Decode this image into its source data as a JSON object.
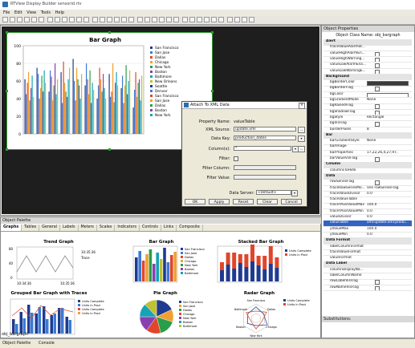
{
  "window": {
    "title": "RTView Display Builder   sensorid.rtv"
  },
  "menu": [
    "File",
    "Edit",
    "View",
    "Tools",
    "Help"
  ],
  "canvas_chart": {
    "title": "Bar Graph",
    "yticks": [
      "100",
      "80",
      "60",
      "40",
      "20",
      "0"
    ],
    "legend": [
      "San Francisco",
      "San Jose",
      "Dallas",
      "Chicago",
      "New York",
      "Boston",
      "Baltimore",
      "New Orleans",
      "Seattle",
      "Denver",
      "San Francisco",
      "San Jose",
      "Dallas",
      "Boston",
      "New York"
    ],
    "bars": [
      [
        62,
        75,
        48,
        70,
        85,
        55,
        40,
        68,
        52,
        30
      ],
      [
        45,
        68,
        72,
        35,
        60,
        80,
        55,
        42,
        66,
        50
      ],
      [
        58,
        40,
        65,
        82,
        38,
        62,
        75,
        48,
        35,
        70
      ],
      [
        70,
        52,
        38,
        58,
        75,
        45,
        62,
        80,
        55,
        42
      ],
      [
        38,
        66,
        55,
        48,
        62,
        72,
        48,
        36,
        78,
        58
      ],
      [
        52,
        48,
        80,
        42,
        55,
        35,
        68,
        58,
        45,
        62
      ],
      [
        66,
        72,
        45,
        62,
        40,
        58,
        52,
        70,
        60,
        38
      ],
      [
        42,
        58,
        62,
        75,
        68,
        50,
        40,
        55,
        72,
        66
      ]
    ],
    "colors": [
      "#1f3b8f",
      "#3a7bd5",
      "#e0462b",
      "#f0a030",
      "#2a9d4a",
      "#8a3fb0",
      "#16a2b8",
      "#c0c030"
    ]
  },
  "dialog": {
    "title": "Attach To XML Data",
    "property_name_label": "Property Name:",
    "property_name_value": "valueTable",
    "xml_source_label": "XML Source:",
    "xml_source_value": "update.xml",
    "data_key_label": "Data Key:",
    "data_key_value": "production_dates",
    "columns_label": "Column(s):",
    "columns_value": "*",
    "filter_label": "Filter:",
    "filter_column_label": "Filter Column:",
    "filter_value_label": "Filter Value:",
    "data_server_label": "Data Server:",
    "data_server_value": "<default>",
    "buttons": [
      "OK",
      "Apply",
      "Reset",
      "Clear",
      "Cancel"
    ]
  },
  "palette": {
    "header": "Object Palette",
    "tabs": [
      "Graphs",
      "Tables",
      "General",
      "Labels",
      "Meters",
      "Scales",
      "Indicators",
      "Controls",
      "Links",
      "Composite"
    ],
    "trend": {
      "title": "Trend Graph",
      "legend": "Trace",
      "time_start": "10:34:36",
      "time_end": "10:35:36",
      "time_top": "10:35:36",
      "yticks": [
        "80",
        "40",
        "0"
      ]
    },
    "bar": {
      "title": "Bar Graph",
      "legend": [
        "San Francisco",
        "San Jose",
        "Dallas",
        "Chicago",
        "New York",
        "Boston",
        "Baltimore"
      ]
    },
    "stacked": {
      "title": "Stacked Bar Graph",
      "legend": [
        "Units Complete",
        "Units in Prod"
      ]
    },
    "grouped": {
      "title": "Grouped Bar Graph with Traces",
      "legend": [
        "Units Complete",
        "Units in Prod",
        "Units Complete",
        "Units in Prod"
      ]
    },
    "pie": {
      "title": "Pie Graph",
      "legend": [
        "San Francisco",
        "San Jose",
        "Dallas",
        "Chicago",
        "New York",
        "Boston",
        "Baltimore"
      ]
    },
    "radar": {
      "title": "Radar Graph",
      "legend": [
        "Units Complete",
        "Units in Prod"
      ],
      "spokes": [
        "San Francisco",
        "Dallas",
        "Chicago",
        "New York",
        "Boston",
        "Baltimore"
      ]
    }
  },
  "props": {
    "header": "Object Properties",
    "class_name": "Object Class Name: obj_bargraph",
    "rows": [
      {
        "section": true,
        "name": "Alert"
      },
      {
        "name": "traceValueAlarmSt...",
        "value": ""
      },
      {
        "name": "valueHighAlarmEn...",
        "value": "",
        "check": true
      },
      {
        "name": "valueHighWarning...",
        "value": "",
        "check": true
      },
      {
        "name": "valueLowAlarmEna...",
        "value": "",
        "check": true
      },
      {
        "name": "valueLowWarningE...",
        "value": "",
        "check": true
      },
      {
        "section": true,
        "name": "Background"
      },
      {
        "name": "bgBorderColor",
        "value": "",
        "swatch": "#3a3a3a"
      },
      {
        "name": "bgBorderFlag",
        "value": "",
        "check": true
      },
      {
        "name": "bgColor",
        "value": "",
        "swatch": "#ffffff"
      },
      {
        "name": "bgGradientMode",
        "value": "None"
      },
      {
        "name": "bgRaisedFlag",
        "value": "",
        "check": true
      },
      {
        "name": "bgShadowFlag",
        "value": "",
        "check": true
      },
      {
        "name": "bgStyle",
        "value": "Rectangle"
      },
      {
        "name": "bgVisFlag",
        "value": "",
        "check": true
      },
      {
        "name": "borderPixels",
        "value": "8"
      },
      {
        "section": true,
        "name": "Bar"
      },
      {
        "name": "barGradientStyle",
        "value": "None"
      },
      {
        "name": "barImage",
        "value": ""
      },
      {
        "name": "barProperties",
        "value": "17,22,26,4,27,97,"
      },
      {
        "name": "barValueVisFlag",
        "value": "",
        "check": true
      },
      {
        "section": true,
        "name": "Column"
      },
      {
        "name": "columnsToHide",
        "value": ""
      },
      {
        "section": true,
        "name": "Data"
      },
      {
        "name": "rowSeriesFlag",
        "value": "",
        "check": true
      },
      {
        "name": "traceRowSeriesMo...",
        "value": "Use rowSeriesFlag"
      },
      {
        "name": "traceValueDivisor",
        "value": "0.0"
      },
      {
        "name": "traceValueTable",
        "value": ""
      },
      {
        "name": "traceYAxisValueMax",
        "value": "100.0"
      },
      {
        "name": "traceYAxisValueMin",
        "value": "0.0"
      },
      {
        "name": "valueDivisor",
        "value": "0.0"
      },
      {
        "name": "valueTable",
        "value": "xml:update.xml:produ...",
        "selected": true
      },
      {
        "name": "yValueMax",
        "value": "100.0"
      },
      {
        "name": "yValueMin",
        "value": "0.0"
      },
      {
        "section": true,
        "name": "Data Format"
      },
      {
        "name": "labelColumnFormat",
        "value": ""
      },
      {
        "name": "traceValueFormat",
        "value": ""
      },
      {
        "name": "valueFormat",
        "value": ""
      },
      {
        "section": true,
        "name": "Data Label"
      },
      {
        "name": "columnDisplayNa...",
        "value": ""
      },
      {
        "name": "labelColumnName",
        "value": ""
      },
      {
        "name": "rowLabelVisFlag",
        "value": "",
        "check": true
      },
      {
        "name": "rowNameVisFlag",
        "value": "",
        "check": true
      }
    ],
    "substitutions": "Substitutions:"
  },
  "status": {
    "object_name": "obj_bargraph",
    "tab_palette": "Object Palette",
    "tab_console": "Console"
  }
}
